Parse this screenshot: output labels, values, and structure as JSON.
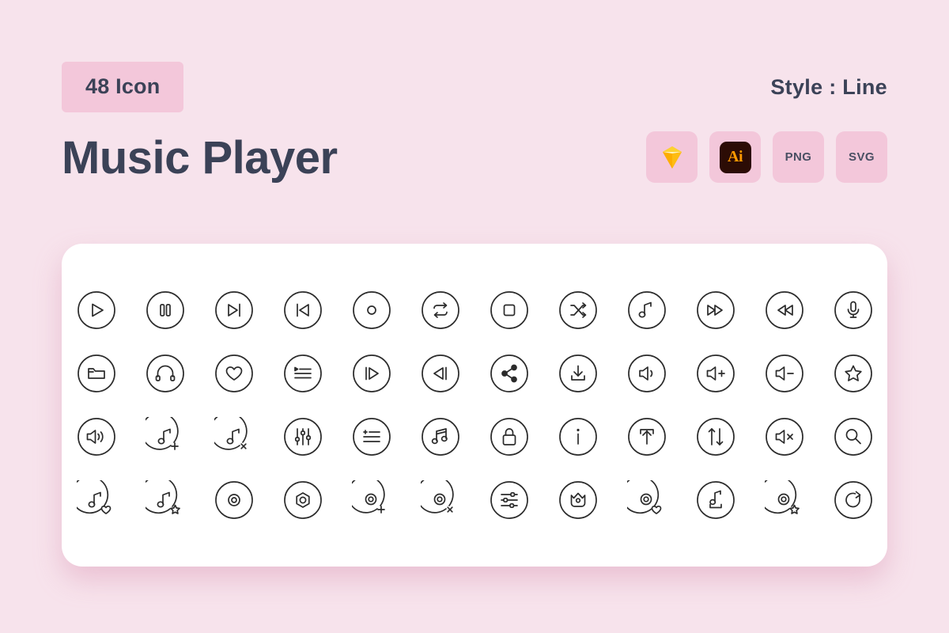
{
  "header": {
    "count_badge": "48 Icon",
    "title": "Music Player",
    "style_label": "Style : Line"
  },
  "formats": [
    {
      "name": "sketch",
      "label": ""
    },
    {
      "name": "illustrator",
      "label": "Ai"
    },
    {
      "name": "png",
      "label": "PNG"
    },
    {
      "name": "svg",
      "label": "SVG"
    }
  ],
  "colors": {
    "background": "#f7e3ec",
    "badge_pink": "#f3c7da",
    "text_dark": "#3b4257",
    "card_white": "#ffffff",
    "icon_stroke": "#2b2b2b",
    "ai_dark": "#2c0c05",
    "ai_orange": "#ff9a00"
  },
  "icons": [
    {
      "index": 1,
      "name": "play-icon"
    },
    {
      "index": 2,
      "name": "pause-icon"
    },
    {
      "index": 3,
      "name": "next-track-icon"
    },
    {
      "index": 4,
      "name": "previous-track-icon"
    },
    {
      "index": 5,
      "name": "record-icon"
    },
    {
      "index": 6,
      "name": "repeat-icon"
    },
    {
      "index": 7,
      "name": "stop-icon"
    },
    {
      "index": 8,
      "name": "shuffle-icon"
    },
    {
      "index": 9,
      "name": "music-note-icon"
    },
    {
      "index": 10,
      "name": "fast-forward-icon"
    },
    {
      "index": 11,
      "name": "rewind-icon"
    },
    {
      "index": 12,
      "name": "microphone-icon"
    },
    {
      "index": 13,
      "name": "folder-icon"
    },
    {
      "index": 14,
      "name": "headphones-icon"
    },
    {
      "index": 15,
      "name": "heart-icon"
    },
    {
      "index": 16,
      "name": "playlist-icon"
    },
    {
      "index": 17,
      "name": "skip-forward-icon"
    },
    {
      "index": 18,
      "name": "skip-back-icon"
    },
    {
      "index": 19,
      "name": "share-icon"
    },
    {
      "index": 20,
      "name": "download-icon"
    },
    {
      "index": 21,
      "name": "volume-icon"
    },
    {
      "index": 22,
      "name": "volume-up-icon"
    },
    {
      "index": 23,
      "name": "volume-down-icon"
    },
    {
      "index": 24,
      "name": "star-icon"
    },
    {
      "index": 25,
      "name": "volume-high-icon"
    },
    {
      "index": 26,
      "name": "add-music-icon"
    },
    {
      "index": 27,
      "name": "remove-music-icon"
    },
    {
      "index": 28,
      "name": "equalizer-vertical-icon"
    },
    {
      "index": 29,
      "name": "add-to-playlist-icon"
    },
    {
      "index": 30,
      "name": "double-music-note-icon"
    },
    {
      "index": 31,
      "name": "lock-icon"
    },
    {
      "index": 32,
      "name": "info-icon"
    },
    {
      "index": 33,
      "name": "upload-icon"
    },
    {
      "index": 34,
      "name": "transfer-icon"
    },
    {
      "index": 35,
      "name": "mute-icon"
    },
    {
      "index": 36,
      "name": "search-icon"
    },
    {
      "index": 37,
      "name": "favorite-music-icon"
    },
    {
      "index": 38,
      "name": "starred-music-icon"
    },
    {
      "index": 39,
      "name": "disc-icon"
    },
    {
      "index": 40,
      "name": "vinyl-hexagon-icon"
    },
    {
      "index": 41,
      "name": "add-disc-icon"
    },
    {
      "index": 42,
      "name": "remove-disc-icon"
    },
    {
      "index": 43,
      "name": "equalizer-horizontal-icon"
    },
    {
      "index": 44,
      "name": "crown-basket-icon"
    },
    {
      "index": 45,
      "name": "favorite-disc-icon"
    },
    {
      "index": 46,
      "name": "download-music-icon"
    },
    {
      "index": 47,
      "name": "starred-disc-icon"
    },
    {
      "index": 48,
      "name": "replay-icon"
    }
  ]
}
